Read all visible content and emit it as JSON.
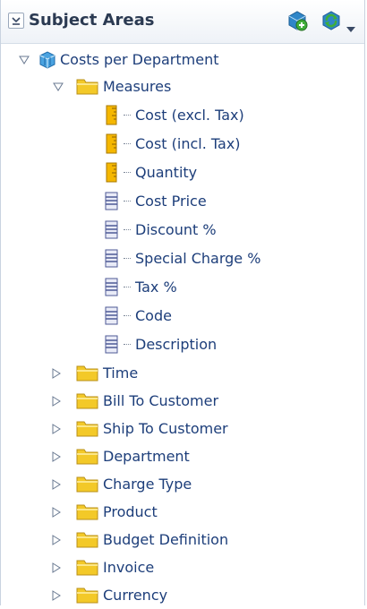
{
  "header": {
    "title": "Subject Areas",
    "add_icon": "add-subject-area-icon",
    "refresh_icon": "refresh-icon",
    "accent": "#2b3a52"
  },
  "tree": {
    "root": {
      "label": "Costs per Department",
      "icon": "cube-icon",
      "expanded": true
    },
    "measures_folder": {
      "label": "Measures",
      "expanded": true
    },
    "measures": [
      {
        "label": "Cost (excl. Tax)",
        "icon": "measure-ruler-icon"
      },
      {
        "label": "Cost (incl. Tax)",
        "icon": "measure-ruler-icon"
      },
      {
        "label": "Quantity",
        "icon": "measure-ruler-icon"
      },
      {
        "label": "Cost Price",
        "icon": "column-icon"
      },
      {
        "label": "Discount %",
        "icon": "column-icon"
      },
      {
        "label": "Special Charge %",
        "icon": "column-icon"
      },
      {
        "label": "Tax %",
        "icon": "column-icon"
      },
      {
        "label": "Code",
        "icon": "column-icon"
      },
      {
        "label": "Description",
        "icon": "column-icon"
      }
    ],
    "folders": [
      {
        "label": "Time",
        "expanded": false
      },
      {
        "label": "Bill To Customer",
        "expanded": false
      },
      {
        "label": "Ship To Customer",
        "expanded": false
      },
      {
        "label": "Department",
        "expanded": false
      },
      {
        "label": "Charge Type",
        "expanded": false
      },
      {
        "label": "Product",
        "expanded": false
      },
      {
        "label": "Budget Definition",
        "expanded": false
      },
      {
        "label": "Invoice",
        "expanded": false
      },
      {
        "label": "Currency",
        "expanded": false
      }
    ]
  }
}
